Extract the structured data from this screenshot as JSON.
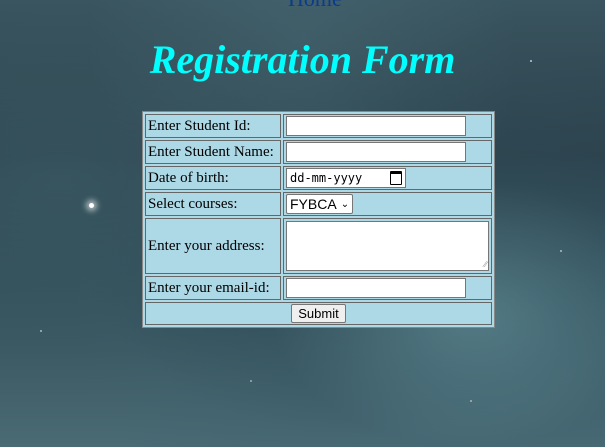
{
  "nav": {
    "home_label": "Home"
  },
  "page": {
    "title": "Registration Form"
  },
  "form": {
    "student_id_label": "Enter Student Id:",
    "student_id_value": "",
    "student_name_label": "Enter Student Name:",
    "student_name_value": "",
    "dob_label": "Date of birth:",
    "dob_placeholder": "dd-mm-yyyy",
    "courses_label": "Select courses:",
    "courses_selected": "FYBCA",
    "address_label": "Enter your address:",
    "address_value": "",
    "email_label": "Enter your email-id:",
    "email_value": "",
    "submit_label": "Submit"
  },
  "colors": {
    "title": "#00ffff",
    "table_bg": "#add8e6",
    "link": "#0b3b8c"
  }
}
